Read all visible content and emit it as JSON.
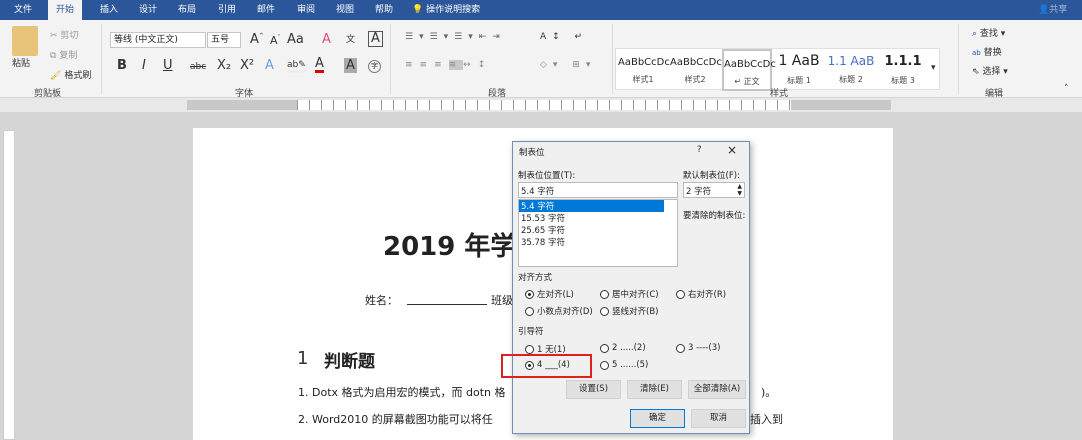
{
  "tabs": [
    "文件",
    "开始",
    "插入",
    "设计",
    "布局",
    "引用",
    "邮件",
    "审阅",
    "视图",
    "帮助",
    "操作说明搜索"
  ],
  "share": "共享",
  "clipboard": {
    "paste": "粘贴",
    "cut": "剪切",
    "copy": "复制",
    "format_painter": "格式刷",
    "label": "剪贴板"
  },
  "font": {
    "name": "等线 (中文正文)",
    "size": "五号",
    "label": "字体",
    "buttons": [
      "B",
      "I",
      "U",
      "abc",
      "X₂",
      "X²",
      "A",
      "A",
      "A",
      "字"
    ],
    "change_case": "Aa",
    "wen": "文"
  },
  "paragraph": {
    "label": "段落"
  },
  "styles": {
    "label": "样式",
    "items": [
      {
        "preview": "AaBbCcDc",
        "name": "样式1"
      },
      {
        "preview": "AaBbCcDc",
        "name": "样式2"
      },
      {
        "preview": "AaBbCcDc",
        "name": "↵ 正文"
      },
      {
        "preview": "1  AaB",
        "name": "标题 1"
      },
      {
        "preview": "1.1  AaB",
        "name": "标题 2"
      },
      {
        "preview": "1.1.1",
        "name": "标题 3"
      }
    ]
  },
  "editing": {
    "find": "查找",
    "replace": "替换",
    "select": "选择",
    "label": "编辑"
  },
  "document": {
    "title": "2019 年学",
    "name_label": "姓名：",
    "class_label": "班级",
    "heading_num": "1",
    "heading": "判断题",
    "q1": "1. Dotx 格式为启用宏的模式，而 dotn 格",
    "q1_end": ")。",
    "q2": "2. Word2010  的屏幕截图功能可以将任",
    "q2_end": "插入到"
  },
  "dialog": {
    "title": "制表位",
    "help": "?",
    "close": "×",
    "position_label": "制表位位置(T):",
    "position_value": "5.4 字符",
    "stops": [
      "5.4 字符",
      "15.53 字符",
      "25.65 字符",
      "35.78 字符"
    ],
    "default_label": "默认制表位(F):",
    "default_value": "2 字符",
    "clear_label": "要清除的制表位:",
    "align_label": "对齐方式",
    "align": [
      {
        "label": "左对齐(L)",
        "on": true
      },
      {
        "label": "居中对齐(C)",
        "on": false
      },
      {
        "label": "右对齐(R)",
        "on": false
      },
      {
        "label": "小数点对齐(D)",
        "on": false
      },
      {
        "label": "竖线对齐(B)",
        "on": false
      }
    ],
    "leader_label": "引导符",
    "leader": [
      {
        "label": "1 无(1)",
        "on": false
      },
      {
        "label": "2 .....(2)",
        "on": false
      },
      {
        "label": "3 ----(3)",
        "on": false
      },
      {
        "label": "4 ___(4)",
        "on": true
      },
      {
        "label": "5 ......(5)",
        "on": false
      }
    ],
    "set": "设置(S)",
    "clear": "清除(E)",
    "clear_all": "全部清除(A)",
    "ok": "确定",
    "cancel": "取消"
  },
  "colors": {
    "accent": "#2b579a",
    "highlight_box": "#e02020"
  }
}
